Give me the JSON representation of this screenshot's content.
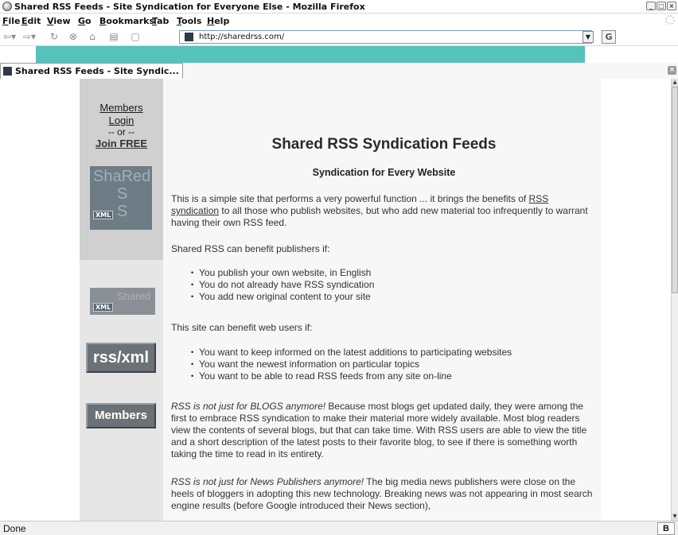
{
  "window": {
    "title": "Shared RSS Feeds - Site Syndication for Everyone Else - Mozilla Firefox"
  },
  "menu": {
    "items": [
      {
        "label": "File"
      },
      {
        "label": "Edit"
      },
      {
        "label": "View"
      },
      {
        "label": "Go"
      },
      {
        "label": "Bookmarks"
      },
      {
        "label": "Tab"
      },
      {
        "label": "Tools"
      },
      {
        "label": "Help"
      }
    ]
  },
  "toolbar": {
    "url": "http://sharedrss.com/",
    "go_label": "G"
  },
  "tabs": [
    {
      "label": "Shared RSS Feeds - Site Syndic..."
    }
  ],
  "sidebar": {
    "members_login_1": "Members",
    "members_login_2": "Login",
    "or_text": "-- or --",
    "join_free": "Join FREE",
    "logo": {
      "line1": "ShaRed",
      "line2": "S",
      "line3": "S",
      "xml": "XML"
    },
    "badge": {
      "text": "Shared",
      "xml": "XML"
    },
    "rss_button": "rss/xml",
    "members_button": "Members"
  },
  "main": {
    "heading": "Shared RSS Syndication Feeds",
    "subheading": "Syndication for Every Website",
    "intro_pre": "This is a simple site that performs a very powerful function ... it brings the benefits of",
    "intro_link": "RSS syndication",
    "intro_post": "to all those who publish websites, but who add new material too infrequently to warrant having their own RSS feed.",
    "publishers_intro": "Shared RSS can benefit publishers if:",
    "publishers_list": [
      "You publish your own website, in English",
      "You do not already have RSS syndication",
      "You add new original content to your site"
    ],
    "users_intro": "This site can benefit web users if:",
    "users_list": [
      "You want to keep informed on the latest additions to participating websites",
      "You want the newest information on particular topics",
      "You want to be able to read RSS feeds from any site on-line"
    ],
    "blogs_em": "RSS is not just for BLOGS anymore!",
    "blogs_text": " Because most blogs get updated daily, they were among the first to embrace RSS syndication to make their material more widely available. Most blog readers view the contents of several blogs, but that can take time. With RSS users are able to view the title and a short description of the latest posts to their favorite blog, to see if there is something worth taking the time to read in its entirety.",
    "news_em": "RSS is not just for News Publishers anymore!",
    "news_text": " The big media news publishers were close on the heels of bloggers in adopting this new technology. Breaking news was not appearing in most search engine results (before Google introduced their News section),"
  },
  "status": {
    "text": "Done",
    "icon_label": "B"
  },
  "colors": {
    "watermark": "#2fb5ad",
    "sidebar": "#e6e6e6",
    "main_background": "#f7f7f7",
    "button": "#6b7277"
  },
  "icons": [
    "app-icon",
    "back-icon",
    "forward-icon",
    "reload-icon",
    "stop-icon",
    "home-icon",
    "print-icon",
    "new-tab-icon",
    "site-icon",
    "close-tab-icon",
    "throbber-icon"
  ]
}
